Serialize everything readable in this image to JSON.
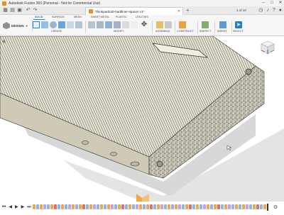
{
  "app": {
    "title": "Autodesk Fusion 360 (Personal - Not for Commercial Use)",
    "window_controls": [
      "–",
      "□",
      "✕"
    ]
  },
  "tabs": {
    "document_title": "Thinkpad240-hardliner-spacer v1*",
    "close_glyph": "✕",
    "add_glyph": "+",
    "count": "1 of 10"
  },
  "toolbar": {
    "design_label": "DESIGN",
    "workspace_tabs": [
      "SOLID",
      "SURFACE",
      "MESH",
      "SHEET METAL",
      "PLASTIC",
      "UTILITIES"
    ],
    "active_workspace": "SOLID",
    "groups": [
      "CREATE",
      "MODIFY",
      "ASSEMBLE",
      "CONSTRUCT",
      "INSPECT",
      "INSERT",
      "SELECT"
    ]
  },
  "colors": {
    "accent": "#1d7fd1",
    "brand": "#f28c1a",
    "model_body": "#e8e4d3",
    "model_edge": "#3a3a3a",
    "shadow": "#dcdcdc"
  },
  "icons": {
    "app_logo": "fusion-logo-icon",
    "viewcube": "viewcube-icon",
    "playback": [
      "skip-start-icon",
      "step-back-icon",
      "play-icon",
      "step-forward-icon",
      "skip-end-icon"
    ],
    "timeline_settings": "gear-icon"
  },
  "timeline": {
    "playback_glyphs": [
      "⏮",
      "◀",
      "▶",
      "▶",
      "⏭"
    ],
    "settings_glyph": "⚙",
    "feature_colors": [
      "#f0a64a",
      "#8fb8e0",
      "#f0a64a",
      "#c9a0dc",
      "#8fb8e0",
      "#f0a64a",
      "#e07070",
      "#8fb8e0",
      "#f0a64a",
      "#8fb8e0",
      "#c9a0dc",
      "#f0a64a",
      "#8fb8e0",
      "#f0a64a",
      "#e07070",
      "#8fb8e0",
      "#f0a64a",
      "#c9a0dc",
      "#8fb8e0",
      "#f0a64a",
      "#8fb8e0",
      "#f0a64a",
      "#c9a0dc",
      "#8fb8e0",
      "#f0a64a",
      "#e07070",
      "#8fb8e0",
      "#f0a64a",
      "#8fb8e0",
      "#c9a0dc",
      "#f0a64a",
      "#8fb8e0",
      "#f0a64a",
      "#e07070",
      "#8fb8e0",
      "#f0a64a",
      "#c9a0dc",
      "#8fb8e0",
      "#f0a64a",
      "#8fb8e0",
      "#f0a64a",
      "#c9a0dc",
      "#8fb8e0",
      "#f0a64a",
      "#e07070",
      "#8fb8e0",
      "#f0a64a",
      "#8fb8e0",
      "#c9a0dc",
      "#f0a64a",
      "#8fb8e0",
      "#f0a64a",
      "#e07070",
      "#8fb8e0",
      "#f0a64a",
      "#c9a0dc",
      "#8fb8e0",
      "#f0a64a",
      "#8fb8e0",
      "#f0a64a",
      "#c9a0dc",
      "#8fb8e0",
      "#f0a64a",
      "#e07070",
      "#8fb8e0",
      "#f0a64a"
    ]
  }
}
